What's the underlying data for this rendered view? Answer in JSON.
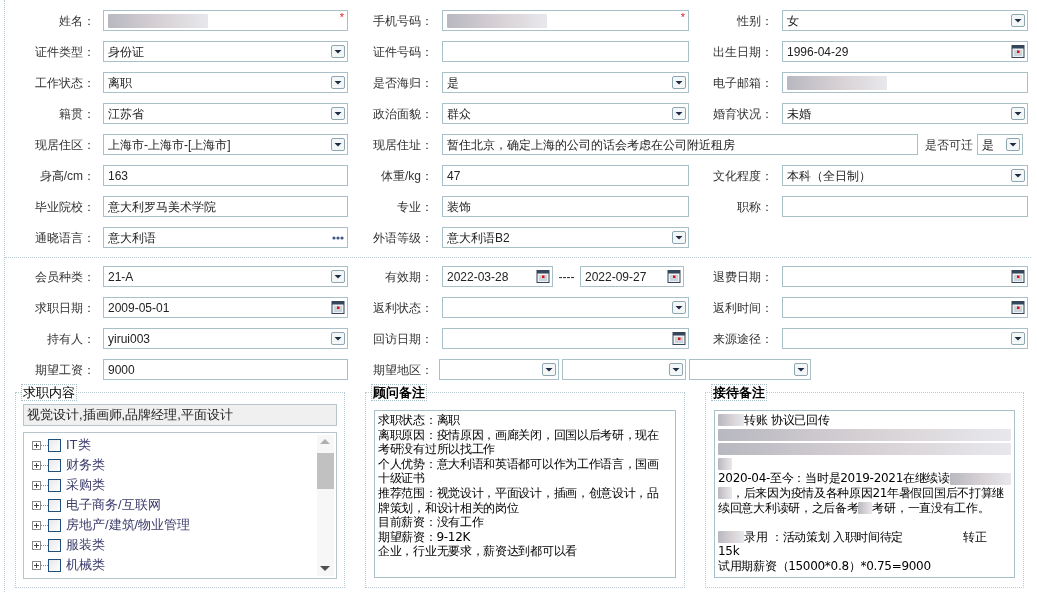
{
  "personal_rows": [
    {
      "cells": [
        {
          "label": "姓名：",
          "kind": "text",
          "redacted": true,
          "required_mark": "*"
        },
        {
          "label": "手机号码：",
          "kind": "text",
          "redacted": true,
          "required_mark": "*"
        },
        {
          "label": "性别：",
          "kind": "select",
          "value": "女"
        }
      ]
    },
    {
      "cells": [
        {
          "label": "证件类型：",
          "kind": "select",
          "value": "身份证"
        },
        {
          "label": "证件号码：",
          "kind": "text"
        },
        {
          "label": "出生日期：",
          "kind": "date",
          "value": "1996-04-29"
        }
      ]
    },
    {
      "cells": [
        {
          "label": "工作状态：",
          "kind": "select",
          "value": "离职"
        },
        {
          "label": "是否海归：",
          "kind": "select",
          "value": "是"
        },
        {
          "label": "电子邮箱：",
          "kind": "text",
          "redacted": true
        }
      ]
    },
    {
      "cells": [
        {
          "label": "籍贯：",
          "kind": "select",
          "value": "江苏省"
        },
        {
          "label": "政治面貌：",
          "kind": "select",
          "value": "群众"
        },
        {
          "label": "婚育状况：",
          "kind": "select",
          "value": "未婚"
        }
      ]
    },
    {
      "cells": [
        {
          "label": "现居住区：",
          "kind": "select",
          "value": "上海市-上海市-[上海市]"
        },
        {
          "label": "现居住址：",
          "kind": "wide-text",
          "value": "暂住北京，确定上海的公司的话会考虑在公司附近租房"
        },
        {
          "label": "是否可迁",
          "kind": "select",
          "value": "是"
        }
      ]
    },
    {
      "cells": [
        {
          "label": "身高/cm：",
          "kind": "text",
          "value": "163"
        },
        {
          "label": "体重/kg：",
          "kind": "text",
          "value": "47"
        },
        {
          "label": "文化程度：",
          "kind": "select",
          "value": "本科（全日制）"
        }
      ]
    },
    {
      "cells": [
        {
          "label": "毕业院校：",
          "kind": "text",
          "value": "意大利罗马美术学院"
        },
        {
          "label": "专业：",
          "kind": "text",
          "value": "装饰"
        },
        {
          "label": "职称：",
          "kind": "text"
        }
      ]
    },
    {
      "cells": [
        {
          "label": "通晓语言：",
          "kind": "lookup",
          "value": "意大利语"
        },
        {
          "label": "外语等级：",
          "kind": "select",
          "value": "意大利语B2"
        }
      ]
    }
  ],
  "membership_rows": [
    {
      "cells": [
        {
          "label": "会员种类：",
          "kind": "select",
          "value": "21-A"
        },
        {
          "label": "有效期：",
          "kind": "range",
          "from": "2022-03-28",
          "separator": "----",
          "to": "2022-09-27"
        },
        {
          "label": "退费日期：",
          "kind": "date"
        }
      ]
    },
    {
      "cells": [
        {
          "label": "求职日期：",
          "kind": "date",
          "value": "2009-05-01"
        },
        {
          "label": "返利状态：",
          "kind": "select"
        },
        {
          "label": "返利时间：",
          "kind": "date"
        }
      ]
    },
    {
      "cells": [
        {
          "label": "持有人：",
          "kind": "select",
          "value": "yirui003"
        },
        {
          "label": "回访日期：",
          "kind": "date"
        },
        {
          "label": "来源途径：",
          "kind": "select"
        }
      ]
    },
    {
      "cells": [
        {
          "label": "期望工资：",
          "kind": "text",
          "value": "9000"
        },
        {
          "label": "期望地区：",
          "kind": "region"
        }
      ]
    }
  ],
  "job_content": {
    "legend": "求职内容",
    "summary": "视觉设计,插画师,品牌经理,平面设计",
    "tree": [
      {
        "label": "IT类",
        "expanded": false,
        "checked": false
      },
      {
        "label": "财务类",
        "expanded": false,
        "checked": false
      },
      {
        "label": "采购类",
        "expanded": false,
        "checked": false
      },
      {
        "label": "电子商务/互联网",
        "expanded": false,
        "checked": false
      },
      {
        "label": "房地产/建筑/物业管理",
        "expanded": false,
        "checked": false
      },
      {
        "label": "服装类",
        "expanded": false,
        "checked": false
      },
      {
        "label": "机械类",
        "expanded": false,
        "checked": false
      }
    ]
  },
  "consultant_notes": {
    "legend": "顾问备注",
    "lines": [
      {
        "parts": [
          {
            "kind": "text",
            "text": "求职状态：离职"
          }
        ]
      },
      {
        "parts": [
          {
            "kind": "text",
            "text": "离职原因：疫情原因，画廊关闭，回国以后考研，现在"
          }
        ]
      },
      {
        "parts": [
          {
            "kind": "text",
            "text": "考研没有过所以找工作"
          }
        ]
      },
      {
        "parts": [
          {
            "kind": "text",
            "text": "个人优势：意大利语和英语都可以作为工作语言，国画"
          }
        ]
      },
      {
        "parts": [
          {
            "kind": "text",
            "text": "十级证书"
          }
        ]
      },
      {
        "parts": [
          {
            "kind": "text",
            "text": "推荐范围：视觉设计，平面设计，插画，创意设计，品"
          }
        ]
      },
      {
        "parts": [
          {
            "kind": "text",
            "text": "牌策划，和设计相关的岗位"
          }
        ]
      },
      {
        "parts": [
          {
            "kind": "text",
            "text": "目前薪资：没有工作"
          }
        ]
      },
      {
        "parts": [
          {
            "kind": "text",
            "text": "期望薪资：9-12K"
          }
        ]
      },
      {
        "parts": [
          {
            "kind": "text",
            "text": "企业，行业无要求，薪资达到都可以看"
          }
        ]
      }
    ]
  },
  "reception_notes": {
    "legend": "接待备注",
    "lines": [
      {
        "parts": [
          {
            "kind": "redacted-short"
          },
          {
            "kind": "text",
            "text": "转账 协议已回传"
          }
        ]
      },
      {
        "parts": [
          {
            "kind": "redacted-line"
          }
        ]
      },
      {
        "parts": [
          {
            "kind": "redacted-line"
          }
        ]
      },
      {
        "parts": [
          {
            "kind": "redacted-tiny"
          }
        ]
      },
      {
        "parts": [
          {
            "kind": "text",
            "text": "2020-04-至今：当时是2019-2021在继续读"
          },
          {
            "kind": "redacted-long"
          }
        ]
      },
      {
        "parts": [
          {
            "kind": "redacted-tiny"
          },
          {
            "kind": "text",
            "text": "，后来因为疫情及各种原因21年暑假回国后不打算继"
          }
        ]
      },
      {
        "parts": [
          {
            "kind": "text",
            "text": "续回意大利读研，之后备考"
          },
          {
            "kind": "redacted-tiny"
          },
          {
            "kind": "text",
            "text": "考研，一直没有工作。"
          }
        ]
      },
      {
        "parts": [
          {
            "kind": "blank"
          }
        ]
      },
      {
        "parts": [
          {
            "kind": "redacted-short"
          },
          {
            "kind": "text",
            "text": "录用 ：活动策划 入职时间待定"
          },
          {
            "kind": "right-text",
            "text": "转正"
          }
        ]
      },
      {
        "parts": [
          {
            "kind": "text",
            "text": "15k"
          }
        ]
      },
      {
        "parts": [
          {
            "kind": "text",
            "text": "试用期薪资（15000*0.8）*0.75=9000"
          }
        ]
      }
    ]
  }
}
